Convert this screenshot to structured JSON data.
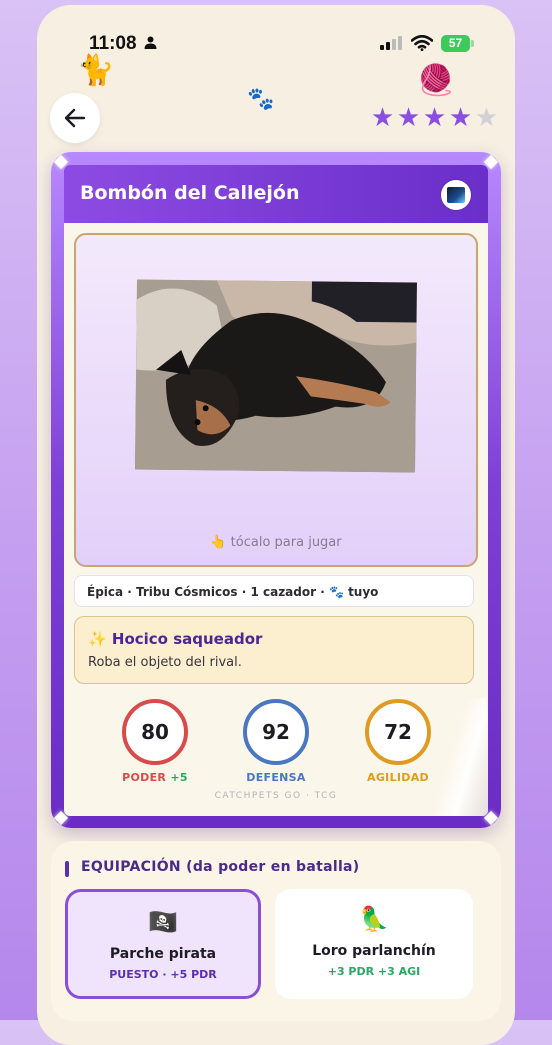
{
  "status_bar": {
    "time": "11:08",
    "battery": "57"
  },
  "rating": {
    "stars_filled": 4,
    "stars_total": 5
  },
  "card": {
    "name": "Bombón del Callejón",
    "tap_hint": "👆 tócalo para jugar",
    "meta": "Épica · Tribu Cósmicos · 1 cazador · 🐾 tuyo",
    "ability": {
      "name": "✨ Hocico saqueador",
      "description": "Roba el objeto del rival."
    },
    "stats": [
      {
        "value": "80",
        "label": "PODER",
        "bonus": "+5",
        "color": "#d94a4a"
      },
      {
        "value": "92",
        "label": "DEFENSA",
        "bonus": "",
        "color": "#4a78c0"
      },
      {
        "value": "72",
        "label": "AGILIDAD",
        "bonus": "",
        "color": "#e09a1f"
      }
    ],
    "footer": "CATCHPETS GO · TCG"
  },
  "equipment": {
    "title": "EQUIPACIÓN (da poder en batalla)",
    "items": [
      {
        "emoji": "🏴‍☠️",
        "name": "Parche pirata",
        "stat": "PUESTO · +5 PDR"
      },
      {
        "emoji": "🦜",
        "name": "Loro parlanchín",
        "stat": "+3 PDR +3 AGI"
      }
    ]
  }
}
